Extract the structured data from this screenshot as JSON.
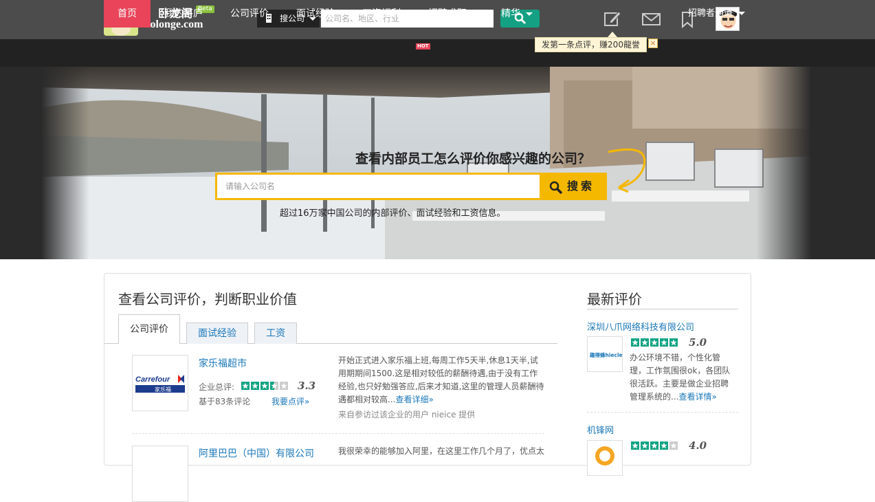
{
  "header": {
    "logo_cn": "卧龙阁",
    "logo_en": "wolonge.com",
    "beta": "Beta",
    "search_type": "搜公司",
    "search_placeholder": "公司名、地区、行业"
  },
  "nav": {
    "items": [
      "首页",
      "我的茅庐",
      "公司评价",
      "面试经验",
      "工资福利",
      "招聘求职",
      "精华"
    ],
    "hot_badge": "HOT",
    "recruiter": "招聘者通道"
  },
  "tooltip": {
    "text": "发第一条点评，赚200龍誉",
    "close": "×"
  },
  "hero": {
    "title": "查看内部员工怎么评价你感兴趣的公司？",
    "placeholder": "请输入公司名",
    "button": "搜索",
    "subtitle": "超过16万家中国公司的内部评价、面试经验和工资信息。"
  },
  "main": {
    "title": "查看公司评价，判断职业价值",
    "tabs": [
      "公司评价",
      "面试经验",
      "工资"
    ],
    "companies": [
      {
        "name": "家乐福超市",
        "logo_text": "Carrefour",
        "logo_sub": "家乐福",
        "rating_label": "企业总评:",
        "rating": 3.3,
        "rating_text": "3.3",
        "count": "基于83条评论",
        "review_link": "我要点评»",
        "review": "开始正式进入家乐福上班,每周工作5天半,休息1天半,试用期期间1500.这是相对较低的薪酬待遇,由于没有工作经验,也只好勉强答应,后来才知道,这里的管理人员薪酬待遇都相对较高...",
        "more": "查看详细»",
        "from": "来自参访过该企业的用户 nieice 提供"
      },
      {
        "name": "阿里巴巴（中国）有限公司",
        "review": "我很荣幸的能够加入阿里，在这里工作几个月了，优点太"
      }
    ]
  },
  "sidebar": {
    "title": "最新评价",
    "items": [
      {
        "company": "深圳八爪网络科技有限公司",
        "logo_text": "趣得蜂hiecle",
        "rating": 5.0,
        "rating_text": "5.0",
        "review": "办公环境不错，个性化管理，工作氛围很ok，各团队很活跃。主要是做企业招聘管理系统的...",
        "more": "查看详情»"
      },
      {
        "company": "机锋网",
        "rating": 4.0,
        "rating_text": "4.0"
      }
    ]
  },
  "colors": {
    "accent_green": "#14a082",
    "nav_active": "#e9445a",
    "hero_yellow": "#f5b800",
    "link_blue": "#1a77b8"
  },
  "icons": [
    "building-icon",
    "search-icon",
    "edit-icon",
    "mail-icon",
    "bookmark-icon",
    "avatar"
  ]
}
